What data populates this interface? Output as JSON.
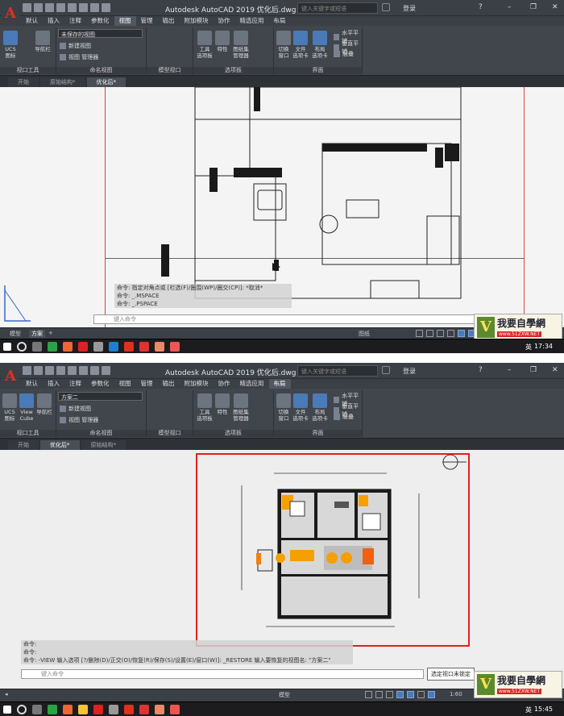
{
  "app": {
    "logo_letter": "A",
    "title_1": "Autodesk AutoCAD 2019   优化后.dwg",
    "title_2": "Autodesk AutoCAD 2019   优化后.dwg",
    "search_placeholder": "键入关键字或短语",
    "login": "登录"
  },
  "menu": [
    "默认",
    "插入",
    "注释",
    "参数化",
    "视图",
    "管理",
    "输出",
    "附加模块",
    "协作",
    "精选应用",
    "布局"
  ],
  "menu_active_1": "视图",
  "menu_active_2": "布局",
  "ribbon_1": {
    "ucs_label": "UCS\n图标",
    "nav_label": "导航栏",
    "view_dropdown": "未保存的视图",
    "new_view": "新建视图",
    "view_manager": "视图 管理器",
    "group_viewport_tools": "视口工具",
    "group_named_views": "命名视图",
    "group_model_viewports": "模型视口",
    "tool_palettes": "工具\n选项板",
    "properties": "特性",
    "sheetset": "图纸集\n管理器",
    "group_palettes": "选项板",
    "switch_window": "切换\n窗口",
    "file_tabs": "文件\n选项卡",
    "layout_tabs": "布局\n选项卡",
    "tile_h": "水平平铺",
    "tile_v": "垂直平铺",
    "cascade": "层叠",
    "group_interface": "界面"
  },
  "ribbon_2": {
    "ucs_label": "UCS\n图标",
    "viewcube_label": "View\nCube",
    "nav_label": "导航栏",
    "view_dropdown": "方案二",
    "new_view": "新建视图",
    "view_manager": "视图 管理器",
    "group_viewport_tools": "视口工具",
    "group_named_views": "命名视图",
    "group_model_viewports": "模型视口",
    "tool_palettes": "工具\n选项板",
    "properties": "特性",
    "sheetset": "图纸集\n管理器",
    "group_palettes": "选项板",
    "switch_window": "切换\n窗口",
    "file_tabs": "文件\n选项卡",
    "layout_tabs": "布局\n选项卡",
    "tile_h": "水平平铺",
    "tile_v": "垂直平铺",
    "cascade": "层叠",
    "group_interface": "界面"
  },
  "tabs_1": [
    "开始",
    "原始结构*",
    "优化后*"
  ],
  "tabs_2": [
    "开始",
    "优化后*",
    "原始结构*"
  ],
  "command_1": {
    "lines": [
      "命令: 指定对角点或 [栏选(F)/圈围(WP)/圈交(CP)]: *取消*",
      "命令: _.MSPACE",
      "命令: _.PSPACE"
    ],
    "placeholder": "键入命令"
  },
  "command_2": {
    "lines": [
      "命令:",
      "命令:",
      "命令: -VIEW 输入选项 [?/删除(D)/正交(O)/恢复(R)/保存(S)/设置(E)/窗口(W)]: _RESTORE 输入要恢复的视图名: \"方案二\""
    ],
    "placeholder": "键入命令"
  },
  "status_1": {
    "model_tab": "模型",
    "layout_tab": "方案",
    "paper": "图纸"
  },
  "status_2": {
    "model_tab": "模型",
    "layout_tab": "方案",
    "paper": "模型",
    "scale": "1:60"
  },
  "tooltip_2": "选定视口未锁定",
  "taskbar_1": {
    "ime": "英",
    "time": "17:34"
  },
  "taskbar_2": {
    "ime": "英",
    "time": "15:45"
  },
  "watermark": {
    "logo": "V",
    "text": "我要自學網",
    "url": "www.51ZXW.NET"
  },
  "colors": {
    "accent": "#4a7ab8",
    "frame": "#e02020",
    "logo": "#e0301e"
  }
}
